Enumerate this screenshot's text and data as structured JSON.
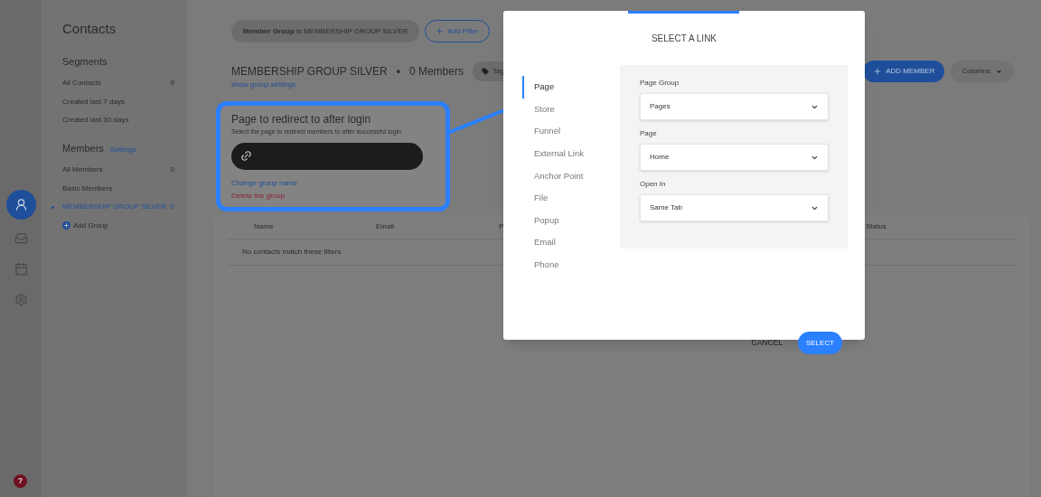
{
  "help": "?",
  "rail": [
    {
      "selected": true
    },
    {
      "selected": false
    },
    {
      "selected": false
    },
    {
      "selected": false
    }
  ],
  "sidebar": {
    "title": "Contacts",
    "segments": {
      "heading": "Segments",
      "items": [
        {
          "label": "All Contacts",
          "count": "0"
        },
        {
          "label": "Created last 7 days"
        },
        {
          "label": "Created last 30 days"
        }
      ]
    },
    "members": {
      "heading": "Members",
      "settings_link": "Settings",
      "items": [
        {
          "label": "All Members",
          "count": "0",
          "selected": false
        },
        {
          "label": "Basic Members",
          "selected": false
        },
        {
          "label": "MEMBERSHIP GROUP SILVER",
          "count": "0",
          "selected": true
        }
      ],
      "add_group": "Add Group"
    }
  },
  "main": {
    "filter_chip": "**Member Group** is MEMBERSHIP GROUP SILVER",
    "add_filter": "Add Filter",
    "group_title": "MEMBERSHIP GROUP SILVER",
    "bullet": "•",
    "members_count": "0 Members",
    "tag_button": "Tag",
    "show_settings": "show group settings",
    "add_member": "ADD MEMBER",
    "columns_button": "Columns",
    "redirect": {
      "title": "Page to redirect to after login",
      "description": "Select the page to redirect members to after successful login",
      "change_name": "Change group name",
      "delete": "Delete the group"
    },
    "table": {
      "columns": [
        "Name",
        "Email",
        "P",
        "Status"
      ],
      "empty": "No contacts match these filters"
    }
  },
  "modal": {
    "title": "SELECT A LINK",
    "link_types": [
      {
        "label": "Page",
        "selected": true
      },
      {
        "label": "Store",
        "selected": false
      },
      {
        "label": "Funnel",
        "selected": false
      },
      {
        "label": "External Link",
        "selected": false
      },
      {
        "label": "Anchor Point",
        "selected": false
      },
      {
        "label": "File",
        "selected": false
      },
      {
        "label": "Popup",
        "selected": false
      },
      {
        "label": "Email",
        "selected": false
      },
      {
        "label": "Phone",
        "selected": false
      }
    ],
    "fields": [
      {
        "label": "Page Group",
        "value": "Pages"
      },
      {
        "label": "Page",
        "value": "Home"
      },
      {
        "label": "Open In",
        "value": "Same Tab"
      }
    ],
    "cancel": "CANCEL",
    "select": "SELECT"
  }
}
